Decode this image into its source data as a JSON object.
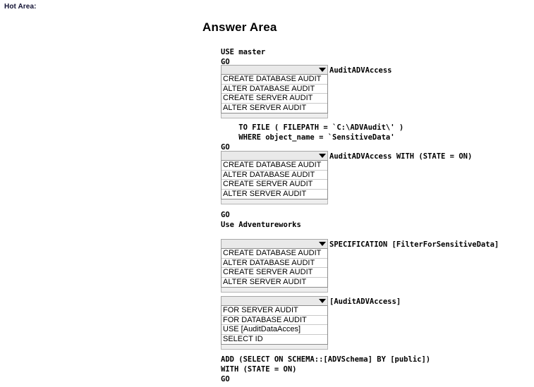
{
  "page": {
    "hot_area_label": "Hot Area:",
    "answer_area_title": "Answer Area"
  },
  "code": {
    "block1": "USE master\nGO",
    "block2": "    TO FILE ( FILEPATH = `C:\\ADVAudit\\' )\n    WHERE object_name = `SensitiveData'\nGO",
    "block3": "GO\nUse Adventureworks",
    "block4": "ADD (SELECT ON SCHEMA::[ADVSchema] BY [public])\nWITH (STATE = ON)\nGO"
  },
  "dropdowns": [
    {
      "id": "dropdown-1",
      "selected": "",
      "trailing_text": "AuditADVAccess",
      "options": [
        "CREATE DATABASE AUDIT",
        "ALTER DATABASE AUDIT",
        "CREATE SERVER AUDIT",
        "ALTER SERVER AUDIT"
      ]
    },
    {
      "id": "dropdown-2",
      "selected": "",
      "trailing_text": "AuditADVAccess WITH (STATE = ON)",
      "options": [
        "CREATE DATABASE AUDIT",
        "ALTER DATABASE AUDIT",
        "CREATE SERVER AUDIT",
        "ALTER SERVER AUDIT"
      ]
    },
    {
      "id": "dropdown-3",
      "selected": "",
      "trailing_text": "SPECIFICATION [FilterForSensitiveData]",
      "options": [
        "CREATE DATABASE AUDIT",
        "ALTER DATABASE AUDIT",
        "CREATE SERVER AUDIT",
        "ALTER SERVER AUDIT"
      ]
    },
    {
      "id": "dropdown-4",
      "selected": "",
      "trailing_text": "[AuditADVAccess]",
      "options": [
        "FOR SERVER AUDIT",
        "FOR DATABASE AUDIT",
        "USE [AuditDataAcces]",
        "SELECT ID"
      ]
    }
  ]
}
